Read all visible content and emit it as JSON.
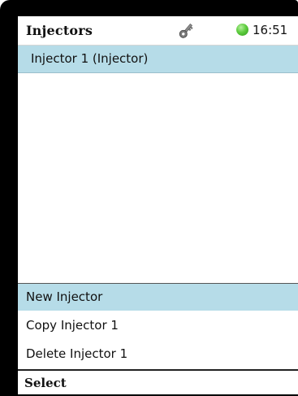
{
  "header": {
    "title": "Injectors",
    "key_icon": "key-icon",
    "status_icon": "status-indicator-icon",
    "status_color": "#4cc42e",
    "time": "16:51"
  },
  "list": {
    "items": [
      {
        "label": "Injector 1 (Injector)",
        "selected": true
      }
    ],
    "highlight_color": "#b6dce8"
  },
  "menu": {
    "items": [
      {
        "label": "New Injector",
        "selected": true
      },
      {
        "label": "Copy Injector 1",
        "selected": false
      },
      {
        "label": "Delete Injector 1",
        "selected": false
      }
    ]
  },
  "softkeys": {
    "left": "Select"
  }
}
